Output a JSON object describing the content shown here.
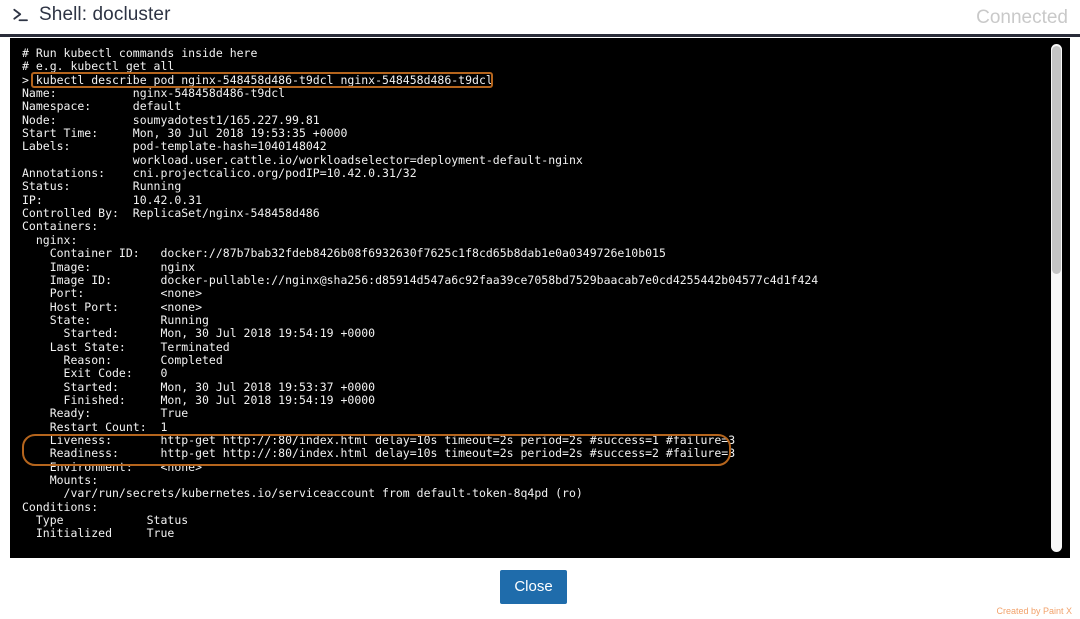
{
  "header": {
    "icon": "terminal-prompt-icon",
    "title": "Shell: docluster",
    "status": "Connected"
  },
  "terminal": {
    "lines": [
      "# Run kubectl commands inside here",
      "# e.g. kubectl get all",
      "> kubectl describe pod nginx-548458d486-t9dcl nginx-548458d486-t9dcl",
      "Name:           nginx-548458d486-t9dcl",
      "Namespace:      default",
      "Node:           soumyadotest1/165.227.99.81",
      "Start Time:     Mon, 30 Jul 2018 19:53:35 +0000",
      "Labels:         pod-template-hash=1040148042",
      "                workload.user.cattle.io/workloadselector=deployment-default-nginx",
      "Annotations:    cni.projectcalico.org/podIP=10.42.0.31/32",
      "Status:         Running",
      "IP:             10.42.0.31",
      "Controlled By:  ReplicaSet/nginx-548458d486",
      "Containers:",
      "  nginx:",
      "    Container ID:   docker://87b7bab32fdeb8426b08f6932630f7625c1f8cd65b8dab1e0a0349726e10b015",
      "    Image:          nginx",
      "    Image ID:       docker-pullable://nginx@sha256:d85914d547a6c92faa39ce7058bd7529baacab7e0cd4255442b04577c4d1f424",
      "    Port:           <none>",
      "    Host Port:      <none>",
      "    State:          Running",
      "      Started:      Mon, 30 Jul 2018 19:54:19 +0000",
      "    Last State:     Terminated",
      "      Reason:       Completed",
      "      Exit Code:    0",
      "      Started:      Mon, 30 Jul 2018 19:53:37 +0000",
      "      Finished:     Mon, 30 Jul 2018 19:54:19 +0000",
      "    Ready:          True",
      "    Restart Count:  1",
      "    Liveness:       http-get http://:80/index.html delay=10s timeout=2s period=2s #success=1 #failure=3",
      "    Readiness:      http-get http://:80/index.html delay=10s timeout=2s period=2s #success=2 #failure=3",
      "    Environment:    <none>",
      "    Mounts:",
      "      /var/run/secrets/kubernetes.io/serviceaccount from default-token-8q4pd (ro)",
      "Conditions:",
      "  Type            Status",
      "  Initialized     True"
    ]
  },
  "annotations": {
    "color": "#b5651d",
    "command_box_target": "> kubectl describe pod nginx-548458d486-t9dcl nginx-548458d486-t9dcl",
    "probes_box_target": "Liveness / Readiness probe lines"
  },
  "scrollbar": {
    "orientation": "vertical",
    "thumb_position_percent": 0
  },
  "footer": {
    "close_label": "Close",
    "close_color": "#1f6cab",
    "watermark": "Created by Paint X"
  }
}
